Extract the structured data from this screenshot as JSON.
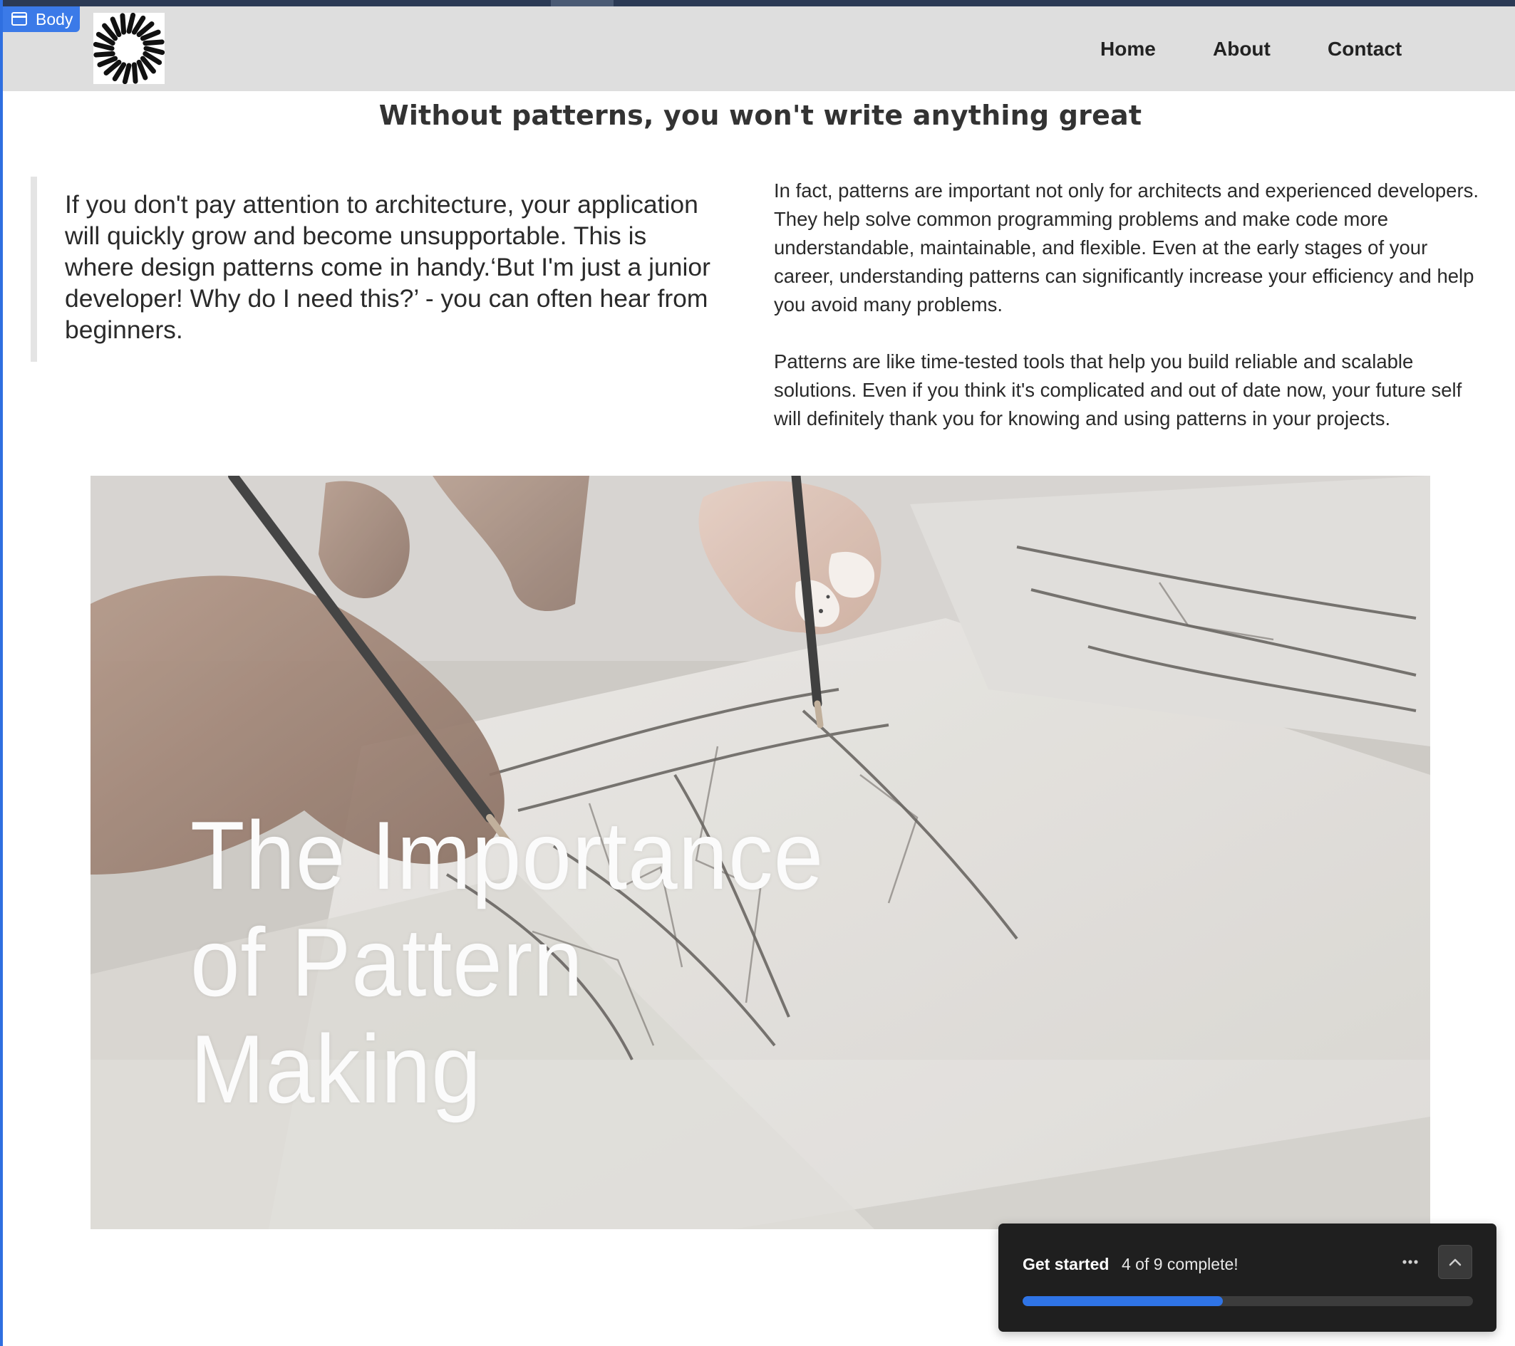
{
  "editor": {
    "selection_badge": "Body",
    "accent_color": "#3b7ae8"
  },
  "header": {
    "logo_icon": "sunburst-logo-icon",
    "nav": {
      "home": "Home",
      "about": "About",
      "contact": "Contact"
    }
  },
  "content": {
    "title": "Without patterns, you won't write anything great",
    "quote": "If you don't pay attention to architecture, your application will quickly grow and become unsupportable. This is where design patterns come in handy.‘But I'm just a junior developer! Why do I need this?’ - you can often hear from beginners.",
    "paragraph_1": "In fact, patterns are important not only for architects and experienced developers. They help solve common programming problems and make code more understandable, maintainable, and flexible. Even at the early stages of your career, understanding patterns can significantly increase your efficiency and help you avoid many problems.",
    "paragraph_2": "Patterns are like time-tested tools that help you build reliable and scalable solutions. Even if you think it's complicated and out of date now, your future self will definitely thank you for knowing and using patterns in your projects."
  },
  "hero": {
    "title_line_1": "The Importance",
    "title_line_2": "of Pattern",
    "title_line_3": "Making"
  },
  "get_started": {
    "title": "Get started",
    "progress_text": "4 of 9 complete!",
    "completed": 4,
    "total": 9,
    "progress_color": "#2f74e6",
    "more_icon": "more-horizontal-icon",
    "collapse_icon": "chevron-up-icon"
  }
}
